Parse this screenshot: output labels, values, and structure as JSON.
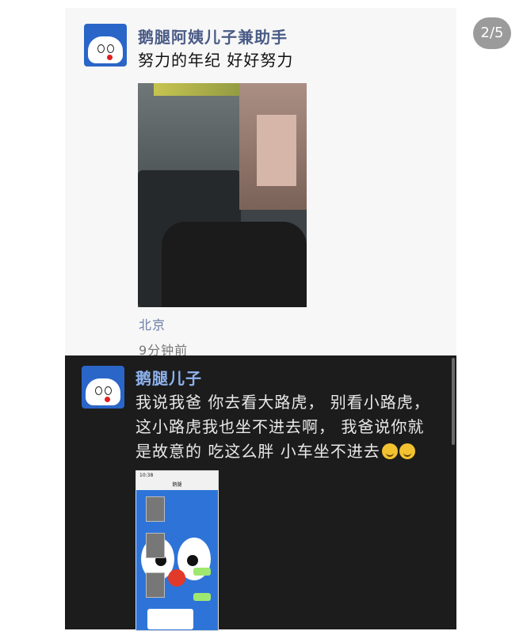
{
  "page_indicator": "2/5",
  "post1": {
    "name": "鹅腿阿姨儿子兼助手",
    "text": "努力的年纪 好好努力",
    "location": "北京",
    "time": "9分钟前"
  },
  "post2": {
    "name": "鹅腿儿子",
    "text_line1": "我说我爸 你去看大路虎，  别看小路虎，",
    "text_line2": "这小路虎我也坐不进去啊，  我爸说你就",
    "text_line3": "是故意的 吃这么胖 小车坐不进去",
    "screenshot": {
      "time": "10:38",
      "title": "鹅腿"
    }
  },
  "colors": {
    "avatar_blue": "#2a66c8",
    "name_light": "#4a5b86",
    "name_dark": "#8eb3ef",
    "dark_bg": "#1c1c1c"
  },
  "icons": {
    "avatar": "doraemon-avatar-icon",
    "emoji": "laughing-emoji-icon"
  }
}
